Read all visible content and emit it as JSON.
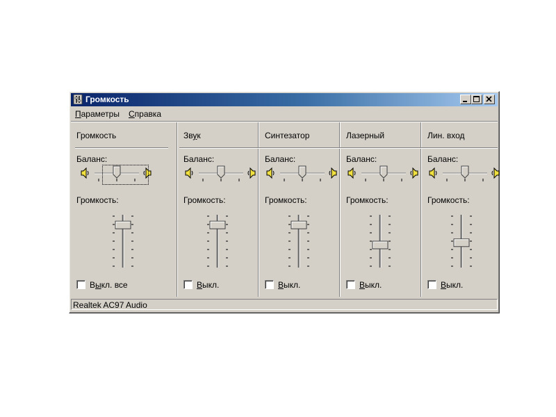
{
  "window": {
    "title": "Громкость"
  },
  "menu": [
    {
      "label_u": "П",
      "label_rest": "араметры"
    },
    {
      "label_u": "С",
      "label_rest": "правка"
    }
  ],
  "balance_label": "Баланс:",
  "volume_label": "Громкость:",
  "channels": [
    {
      "name": "Громкость",
      "mute_pre": "В",
      "mute_u": "ы",
      "mute_post": "кл. все",
      "balance": 0.5,
      "volume": 0.95,
      "muted": false
    },
    {
      "name_pre": "Зв",
      "name_u": "у",
      "name_post": "к",
      "mute_pre": "",
      "mute_u": "В",
      "mute_post": "ыкл.",
      "balance": 0.5,
      "volume": 0.95,
      "muted": false
    },
    {
      "name": "Синтезатор",
      "mute_pre": "",
      "mute_u": "В",
      "mute_post": "ыкл.",
      "balance": 0.5,
      "volume": 0.95,
      "muted": false
    },
    {
      "name": "Лазерный",
      "mute_pre": "",
      "mute_u": "В",
      "mute_post": "ыкл.",
      "balance": 0.5,
      "volume": 0.5,
      "muted": false
    },
    {
      "name": "Лин. вход",
      "mute_pre": "",
      "mute_u": "В",
      "mute_post": "ыкл.",
      "balance": 0.5,
      "volume": 0.55,
      "muted": false
    }
  ],
  "status": {
    "device": "Realtek AC97 Audio"
  },
  "icons": {
    "speaker": "speaker-icon",
    "app": "volume-app-icon"
  }
}
